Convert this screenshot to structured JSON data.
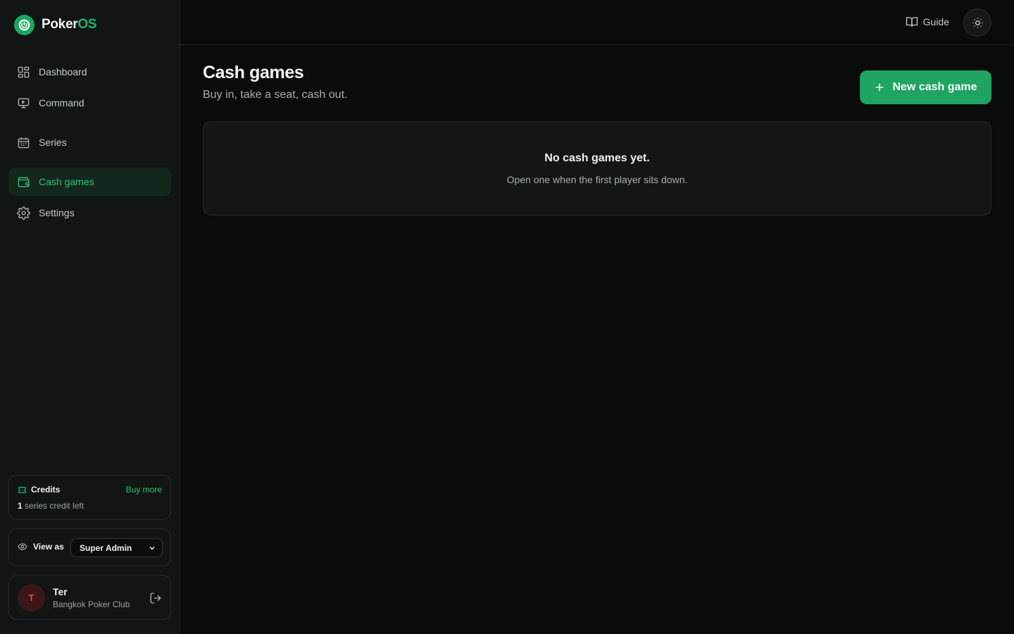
{
  "brand": {
    "name_primary": "Poker",
    "name_accent": "OS"
  },
  "sidebar": {
    "items": [
      {
        "label": "Dashboard",
        "icon": "dashboard-grid-icon"
      },
      {
        "label": "Command",
        "icon": "monitor-icon"
      },
      {
        "label": "Series",
        "icon": "calendar-icon"
      },
      {
        "label": "Cash games",
        "icon": "wallet-icon",
        "active": true
      },
      {
        "label": "Settings",
        "icon": "gear-icon"
      }
    ],
    "credits": {
      "title": "Credits",
      "buy_more": "Buy more",
      "count": "1",
      "suffix": "series credit left"
    },
    "view_as": {
      "label": "View as",
      "selected": "Super Admin"
    },
    "user": {
      "initial": "T",
      "name": "Ter",
      "club": "Bangkok Poker Club"
    }
  },
  "topbar": {
    "guide_label": "Guide"
  },
  "main": {
    "title": "Cash games",
    "subtitle": "Buy in, take a seat, cash out.",
    "new_button": "New cash game",
    "empty_title": "No cash games yet.",
    "empty_subtitle": "Open one when the first player sits down."
  },
  "colors": {
    "accent": "#1fa463",
    "accent_text": "#2fc47a",
    "background": "#0a0b0b",
    "sidebar": "#111614"
  }
}
